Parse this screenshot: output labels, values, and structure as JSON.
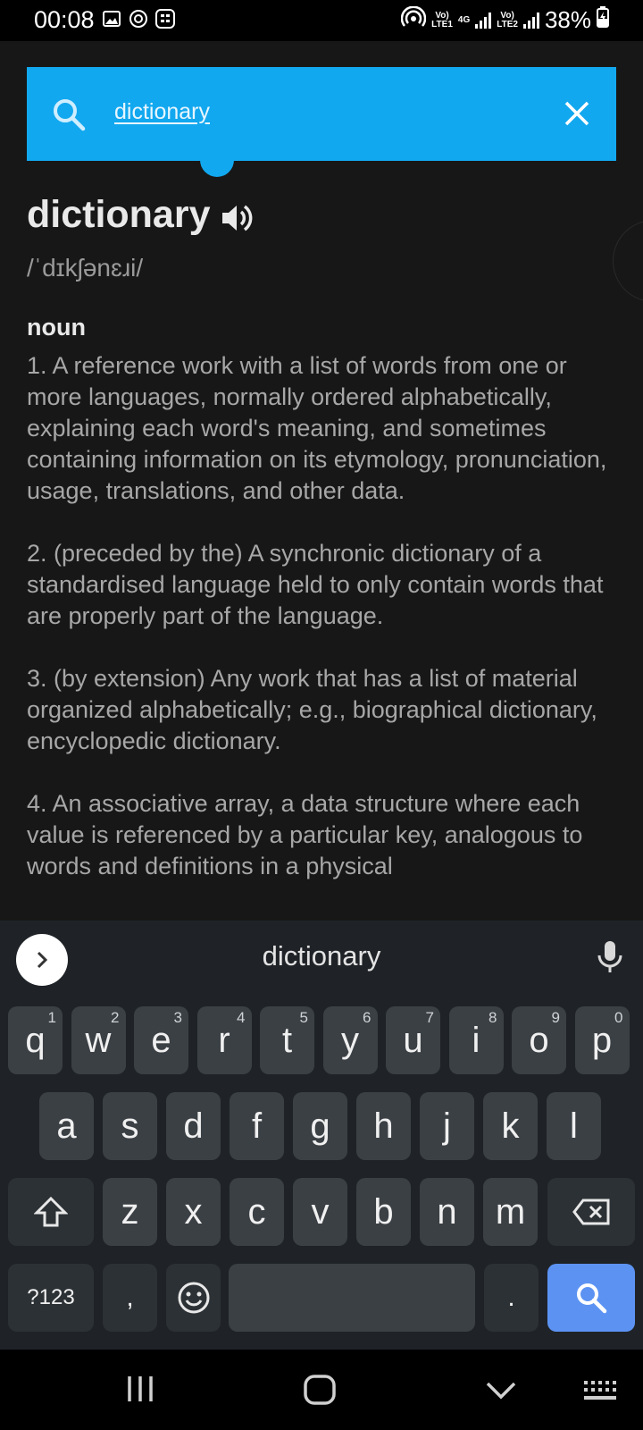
{
  "status_bar": {
    "time": "00:08",
    "battery": "38%",
    "sim1_label": "Vo)\nLTE1",
    "net_label": "4G",
    "sim2_label": "Vo)\nLTE2"
  },
  "search": {
    "query": "dictionary"
  },
  "entry": {
    "word": "dictionary",
    "pronunciation": "/ˈdɪkʃənɛɹi/",
    "part_of_speech": "noun",
    "definitions": [
      "1. A reference work with a list of words from one or more languages, normally ordered alphabetically, explaining each word's meaning, and sometimes containing information on its etymology, pronunciation, usage, translations, and other data.",
      "2. (preceded by the) A synchronic dictionary of a standardised language held to only contain words that are properly part of the language.",
      "3. (by extension) Any work that has a list of material organized alphabetically; e.g., biographical dictionary, encyclopedic dictionary.",
      "4. An associative array, a data structure where each value is referenced by a particular key, analogous to words and definitions in a physical"
    ]
  },
  "keyboard": {
    "suggestion": "dictionary",
    "row1": [
      {
        "k": "q",
        "h": "1"
      },
      {
        "k": "w",
        "h": "2"
      },
      {
        "k": "e",
        "h": "3"
      },
      {
        "k": "r",
        "h": "4"
      },
      {
        "k": "t",
        "h": "5"
      },
      {
        "k": "y",
        "h": "6"
      },
      {
        "k": "u",
        "h": "7"
      },
      {
        "k": "i",
        "h": "8"
      },
      {
        "k": "o",
        "h": "9"
      },
      {
        "k": "p",
        "h": "0"
      }
    ],
    "row2": [
      "a",
      "s",
      "d",
      "f",
      "g",
      "h",
      "j",
      "k",
      "l"
    ],
    "row3": [
      "z",
      "x",
      "c",
      "v",
      "b",
      "n",
      "m"
    ],
    "symbols_label": "?123",
    "comma": ",",
    "period": "."
  }
}
